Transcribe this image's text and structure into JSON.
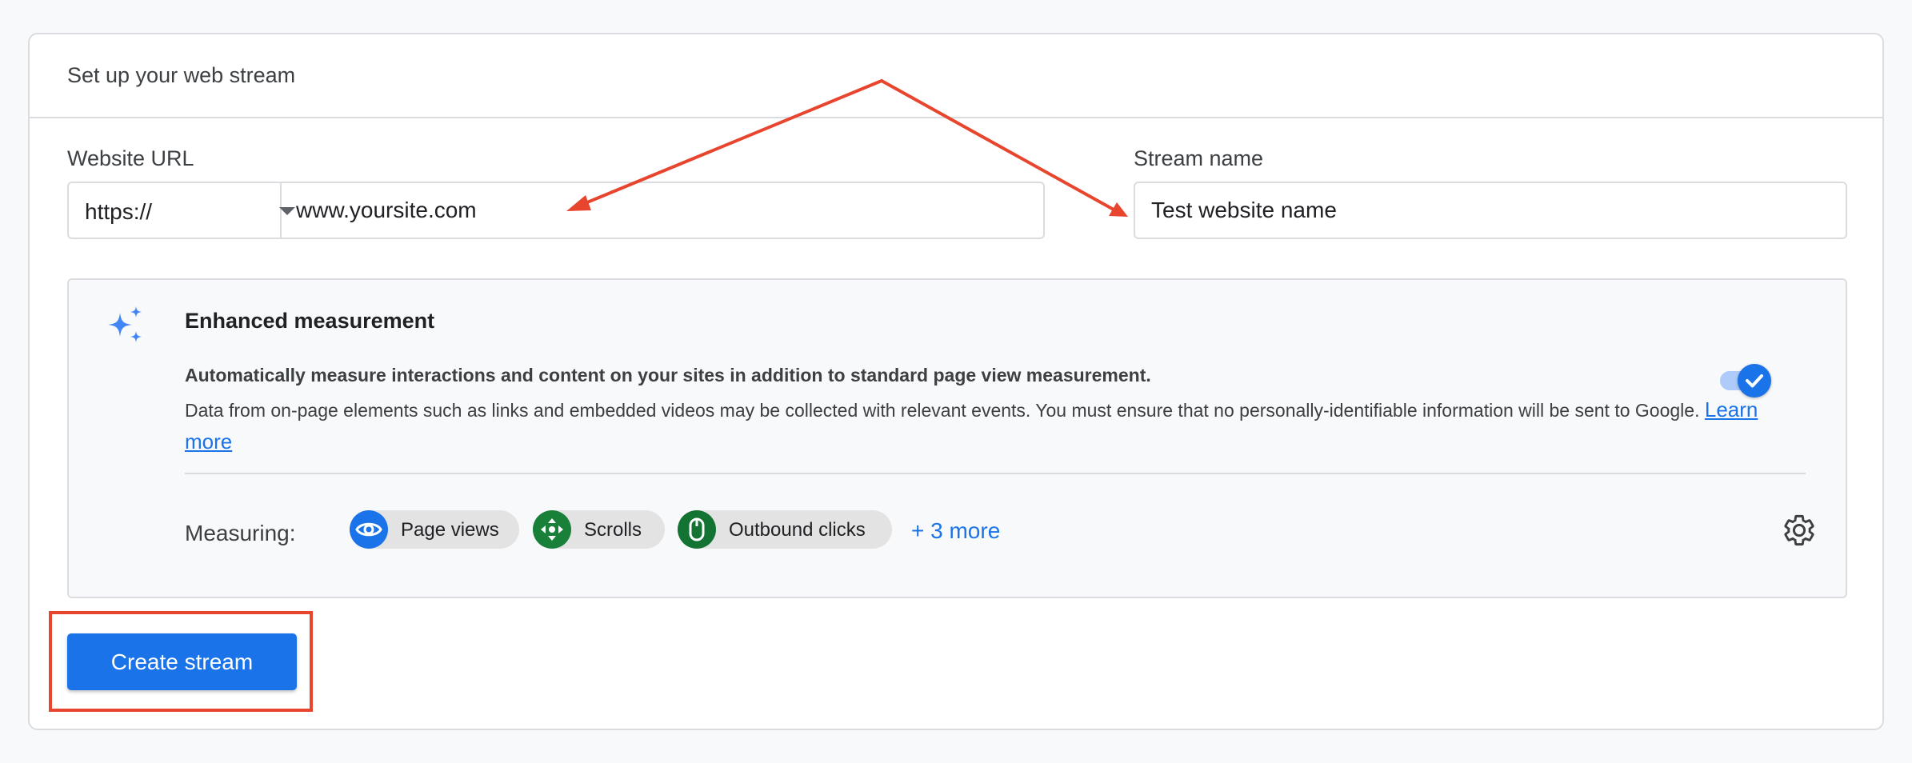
{
  "card": {
    "title": "Set up your web stream"
  },
  "website_url": {
    "label": "Website URL",
    "protocol": "https://",
    "value": "www.yoursite.com"
  },
  "stream_name": {
    "label": "Stream name",
    "value": "Test website name"
  },
  "enhanced_measurement": {
    "title": "Enhanced measurement",
    "description_bold": "Automatically measure interactions and content on your sites in addition to standard page view measurement.",
    "description": "Data from on-page elements such as links and embedded videos may be collected with relevant events. You must ensure that no personally-identifiable information will be sent to Google. ",
    "learn_more": "Learn more",
    "toggle_on": true,
    "measuring_label": "Measuring:",
    "chips": [
      {
        "label": "Page views",
        "icon": "eye-icon",
        "color": "#1a73e8"
      },
      {
        "label": "Scrolls",
        "icon": "scroll-arrows-icon",
        "color": "#188038"
      },
      {
        "label": "Outbound clicks",
        "icon": "mouse-icon",
        "color": "#137333"
      }
    ],
    "more_link": "+ 3 more"
  },
  "actions": {
    "create_label": "Create stream"
  },
  "colors": {
    "primary": "#1a73e8",
    "annotation": "#e8452f",
    "border": "#dadce0"
  }
}
